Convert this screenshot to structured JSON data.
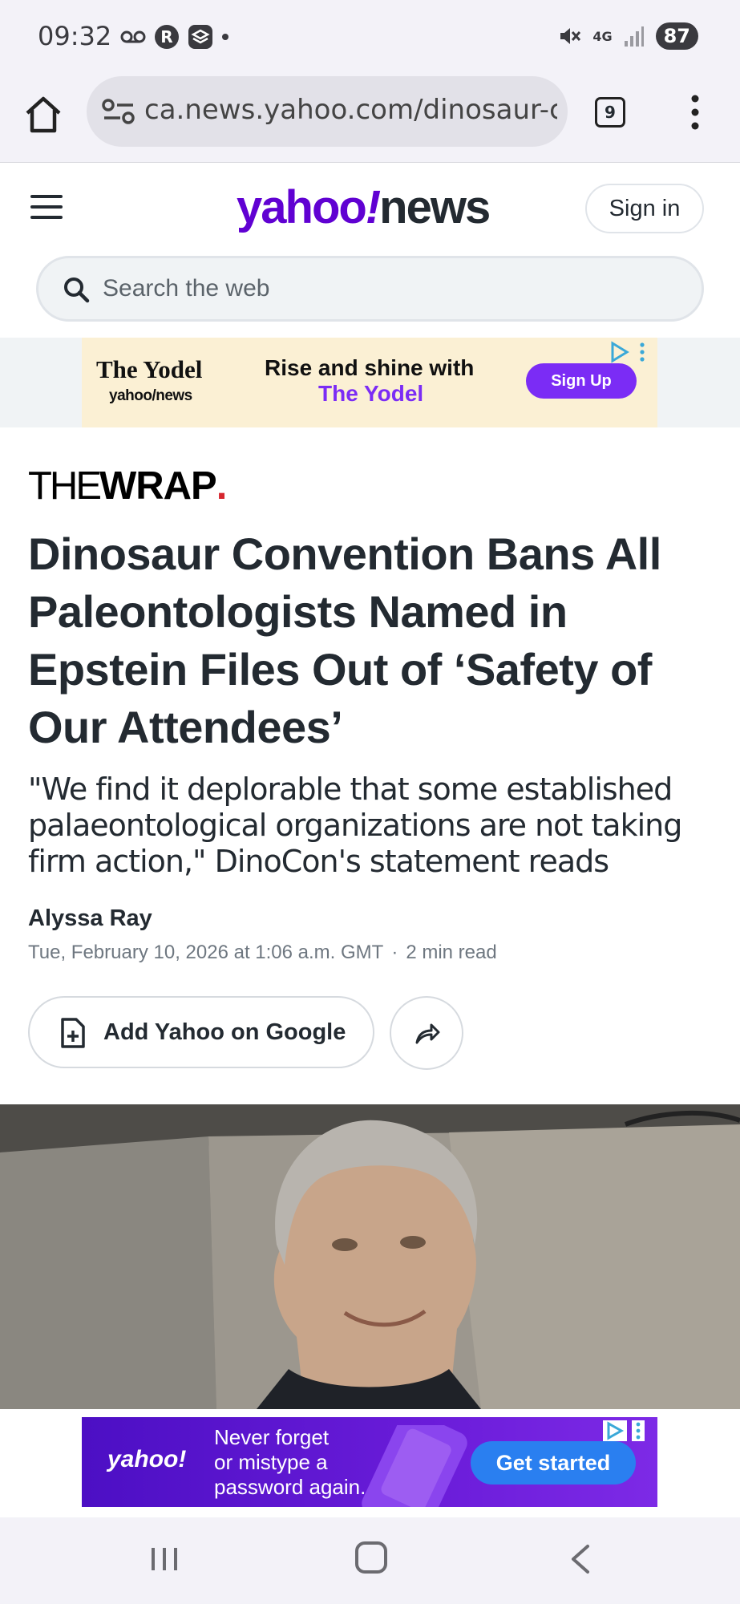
{
  "status_bar": {
    "time": "09:32",
    "network": "4G",
    "battery": "87",
    "icons": [
      "voicemail-icon",
      "r-app-icon",
      "stack-app-icon",
      "dot-icon",
      "mute-icon",
      "signal-icon"
    ]
  },
  "browser": {
    "url": "ca.news.yahoo.com/dinosaur-c",
    "tab_count": "9",
    "icons": [
      "home-icon",
      "site-info-icon",
      "more-vert-icon"
    ]
  },
  "header": {
    "logo_yahoo": "yahoo",
    "logo_bang": "!",
    "logo_news": "news",
    "sign_in": "Sign in",
    "search_placeholder": "Search the web"
  },
  "ad_top": {
    "brand": "The Yodel",
    "brand_sub": "yahoo/news",
    "tagline_1": "Rise and shine with",
    "tagline_2": "The Yodel",
    "cta": "Sign Up"
  },
  "article": {
    "source_thin": "THE",
    "source_bold": "WRAP",
    "source_dot": ".",
    "headline": "Dinosaur Convention Bans All Paleontologists Named in Epstein Files Out of ‘Safety of Our Attendees’",
    "subhead": "\"We find it deplorable that some established palaeontological organizations are not taking firm action,\" DinoCon's statement reads",
    "author": "Alyssa Ray",
    "date": "Tue, February 10, 2026 at 1:06 a.m. GMT",
    "separator": "·",
    "read_time": "2 min read",
    "add_google_label": "Add Yahoo on Google"
  },
  "ad_bottom": {
    "logo": "yahoo!",
    "line_1": "Never forget",
    "line_2": "or mistype a",
    "line_3": "password again.",
    "cta": "Get started"
  },
  "colors": {
    "yahoo_purple": "#6001d2",
    "text_dark": "#232a31",
    "text_muted": "#6e7780",
    "wrap_red": "#d6262e",
    "ad_blue": "#2a7ff0",
    "yodel_bg": "#fbf0d4"
  }
}
